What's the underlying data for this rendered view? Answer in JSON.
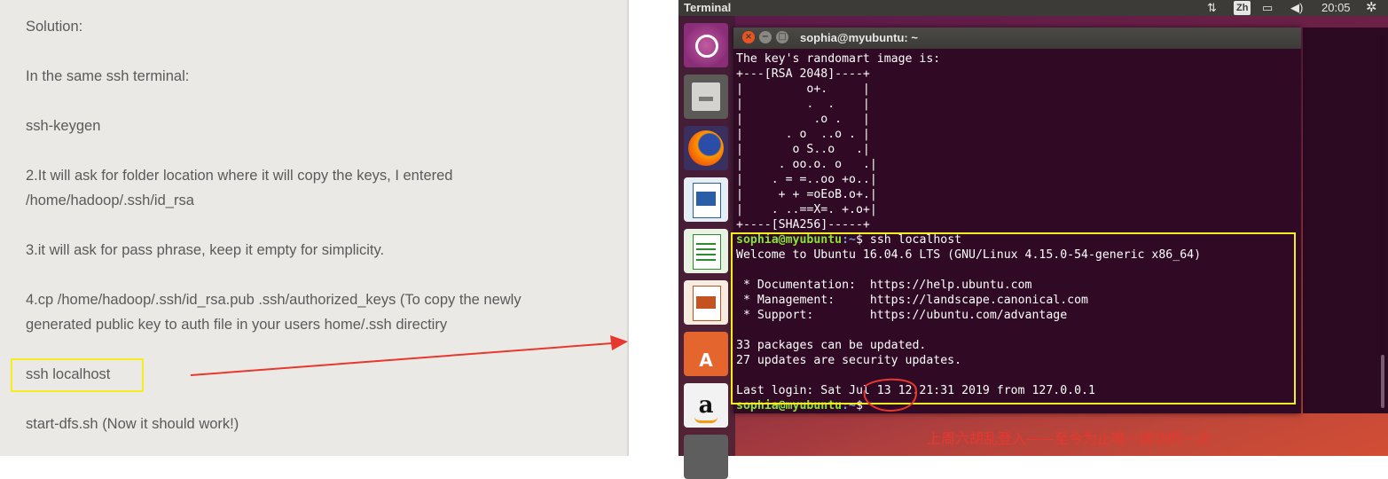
{
  "document": {
    "lines": [
      "Solution:",
      "In the same ssh terminal:",
      "ssh-keygen",
      "2.It will ask for folder location where it will copy the keys, I entered",
      "/home/hadoop/.ssh/id_rsa",
      "3.it will ask for pass phrase, keep it empty for simplicity.",
      "4.cp /home/hadoop/.ssh/id_rsa.pub .ssh/authorized_keys (To copy the newly",
      "generated public key to auth file in your users home/.ssh directiry",
      "ssh localhost",
      "start-dfs.sh (Now it should work!)"
    ]
  },
  "topbar": {
    "app_title": "Terminal",
    "input_method": "Zh",
    "clock": "20:05",
    "icons": [
      "network-icon",
      "keyboard-icon",
      "battery-icon",
      "volume-icon",
      "settings-icon"
    ]
  },
  "launcher": {
    "items": [
      "ubuntu-dash-icon",
      "files-icon",
      "firefox-icon",
      "writer-icon",
      "calc-icon",
      "impress-icon",
      "software-center-icon",
      "amazon-icon",
      "app-icon"
    ]
  },
  "terminal": {
    "window_title": "sophia@myubuntu: ~",
    "randomart_header": "The key's randomart image is:",
    "randomart": [
      "+---[RSA 2048]----+",
      "|         o+.     |",
      "|         .  .    |",
      "|          .o .   |",
      "|      . o  ..o . |",
      "|       o S..o   .|",
      "|     . oo.o. o   .|",
      "|    . = =..oo +o..|",
      "|     + + =oEoB.o+.|",
      "|    . ..==X=. +.o+|",
      "+----[SHA256]-----+"
    ],
    "prompt_user": "sophia@myubuntu",
    "prompt_path": ":~",
    "prompt_symbol": "$",
    "command": " ssh localhost",
    "welcome": "Welcome to Ubuntu 16.04.6 LTS (GNU/Linux 4.15.0-54-generic x86_64)",
    "links": [
      " * Documentation:  https://help.ubuntu.com",
      " * Management:     https://landscape.canonical.com",
      " * Support:        https://ubuntu.com/advantage"
    ],
    "updates": [
      "33 packages can be updated.",
      "27 updates are security updates."
    ],
    "last_login": "Last login: Sat Jul 13 12:21:31 2019 from 127.0.0.1",
    "final_prompt_symbol": "$"
  },
  "annotation": {
    "note": "上周六胡乱登入——至今为止唯一成功的一次",
    "highlight_color": "#f7ec1d",
    "arrow_color": "#e8382e"
  }
}
